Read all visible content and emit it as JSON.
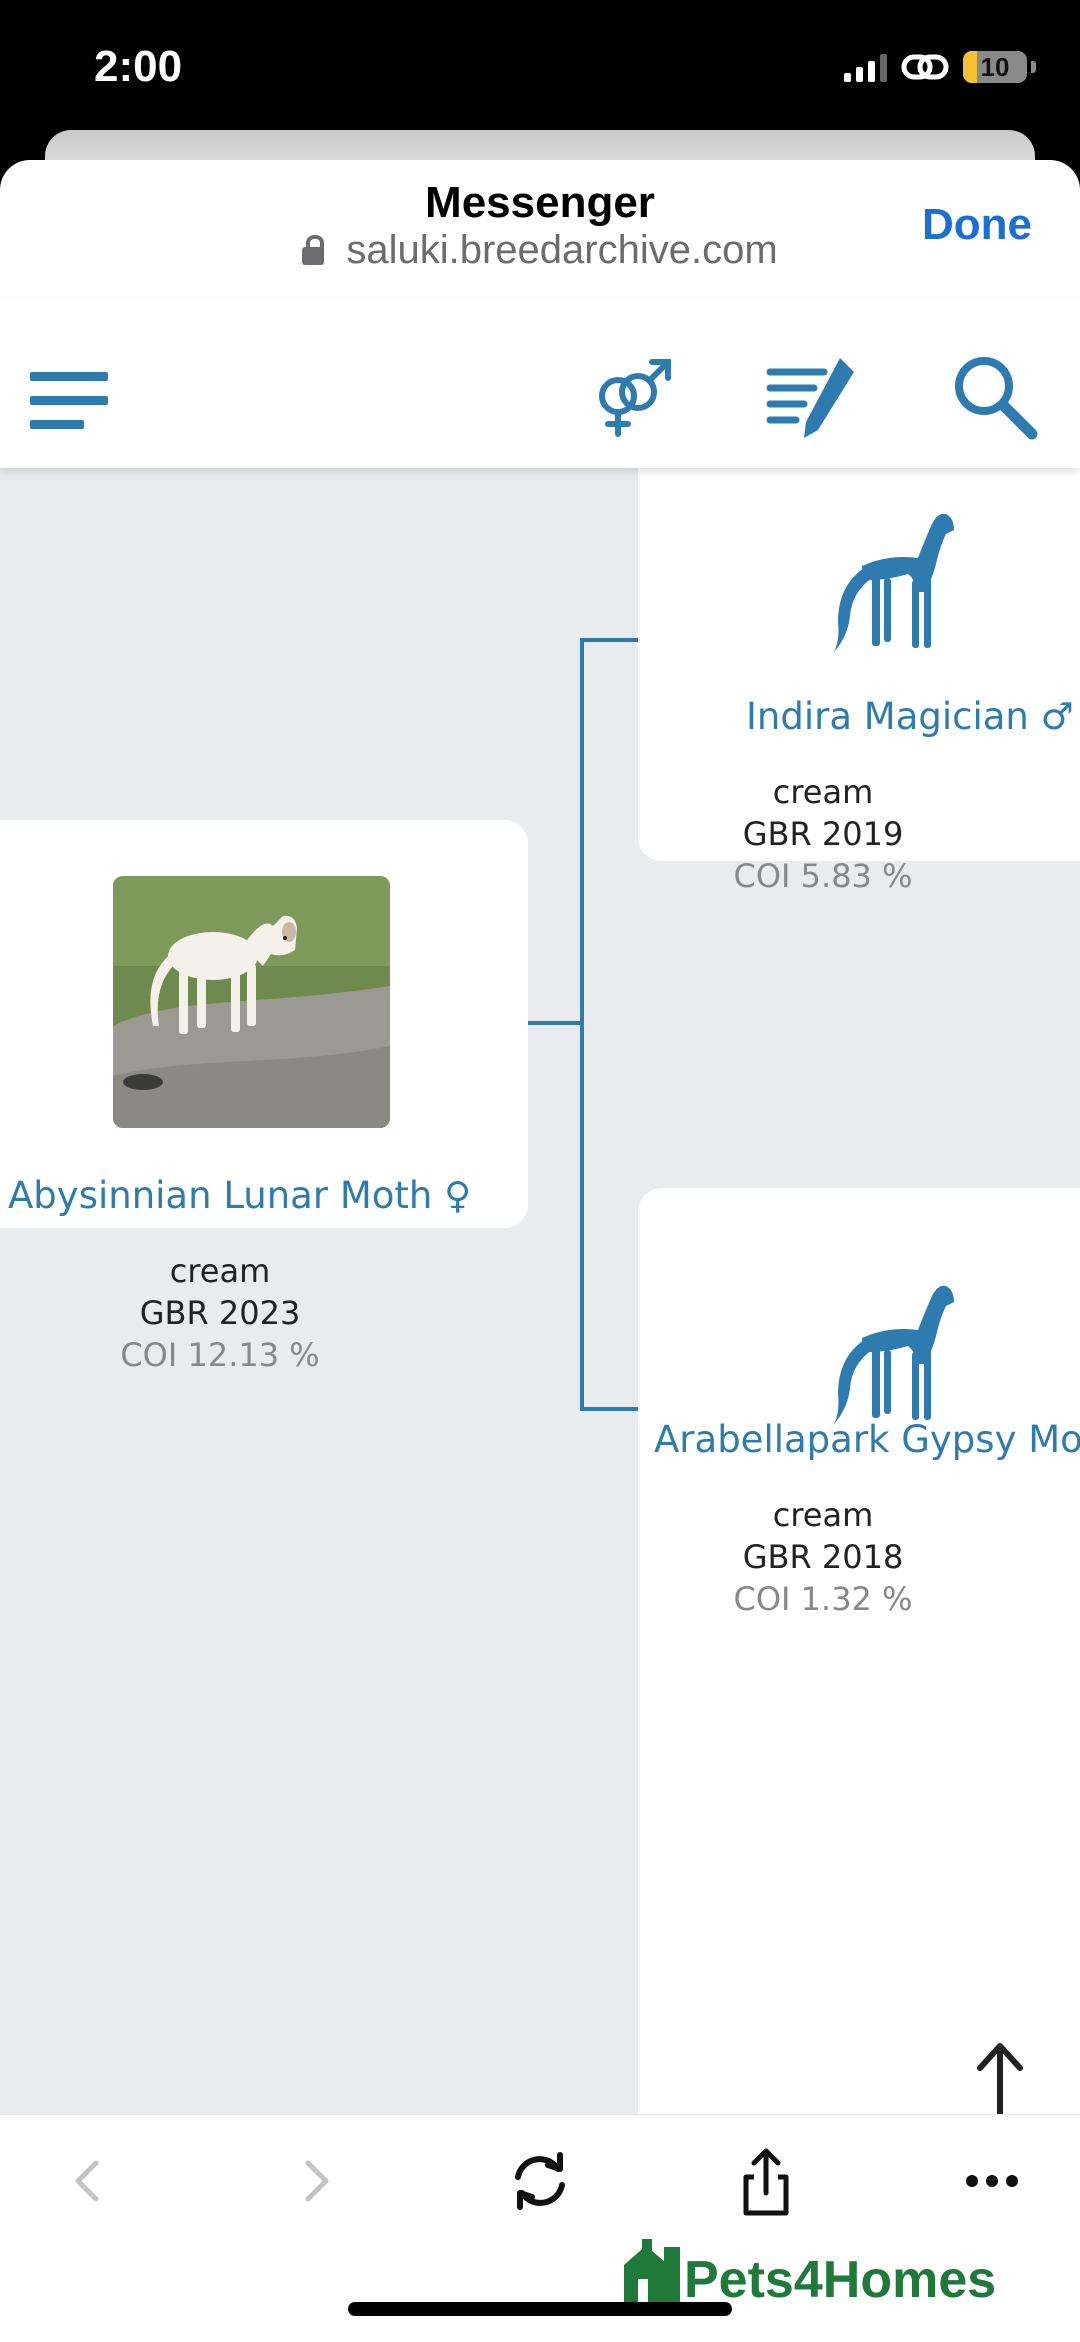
{
  "status_bar": {
    "time": "2:00",
    "battery": "10"
  },
  "browser": {
    "title": "Messenger",
    "url": "saluki.breedarchive.com",
    "done_label": "Done"
  },
  "header_icons": [
    "menu-icon",
    "gender-icon",
    "pedigree-edit-icon",
    "search-icon"
  ],
  "pedigree": {
    "subject": {
      "name": "Abysinnian Lunar Moth",
      "sex_symbol": "♀",
      "color": "cream",
      "country_year": "GBR 2023",
      "coi": "COI 12.13 %"
    },
    "sire": {
      "name": "Indira Magician",
      "sex_symbol": "♂",
      "color": "cream",
      "country_year": "GBR 2019",
      "coi": "COI 5.83 %"
    },
    "dam": {
      "name": "Arabellapark Gypsy Mo",
      "color": "cream",
      "country_year": "GBR 2018",
      "coi": "COI 1.32 %"
    }
  },
  "toolbar": {
    "items": [
      "back-icon",
      "forward-icon",
      "reload-icon",
      "share-icon",
      "more-icon"
    ]
  },
  "ad": {
    "text": "Pets4Homes"
  },
  "colors": {
    "accent": "#2e7bb0",
    "done": "#1a6fd1",
    "ad_green": "#1f7a3a",
    "background": "#e9ecef"
  }
}
